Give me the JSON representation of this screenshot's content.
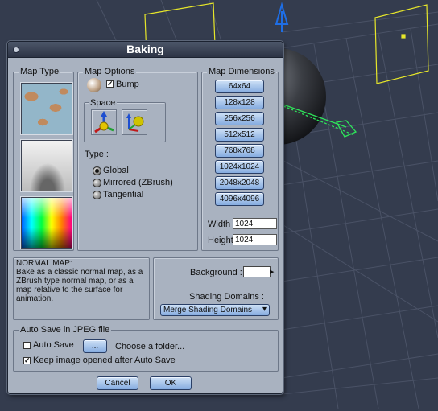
{
  "dialog": {
    "title": "Baking",
    "map_type": {
      "label": "Map Type"
    },
    "map_options": {
      "label": "Map Options",
      "bump_label": "Bump",
      "space_label": "Space",
      "type_label": "Type :",
      "types": [
        "Global",
        "Mirrored (ZBrush)",
        "Tangential"
      ],
      "selected_type": "Global"
    },
    "map_dimensions": {
      "label": "Map Dimensions",
      "sizes": [
        "64x64",
        "128x128",
        "256x256",
        "512x512",
        "768x768",
        "1024x1024",
        "2048x2048",
        "4096x4096"
      ],
      "width_label": "Width",
      "width_value": "1024",
      "height_label": "Height",
      "height_value": "1024"
    },
    "description": "NORMAL MAP:\nBake as a classic normal map, as a ZBrush type normal map, or as a map relative to the surface for animation.",
    "background_label": "Background :",
    "background_color": "#ffffff",
    "shading_domains_label": "Shading Domains :",
    "shading_domains_value": "Merge Shading Domains",
    "autosave": {
      "label": "Auto Save in JPEG file",
      "auto_save_label": "Auto Save",
      "browse_label": "...",
      "folder_label": "Choose a folder...",
      "keep_image_label": "Keep image opened after Auto Save"
    },
    "cancel_label": "Cancel",
    "ok_label": "OK"
  },
  "colors": {
    "accent_button": "#a9c6ec",
    "viewport_bg": "#343c4e",
    "helper_yellow": "#e6e62a",
    "axis_blue": "#1e6ee6",
    "axis_green": "#2ee65a"
  }
}
